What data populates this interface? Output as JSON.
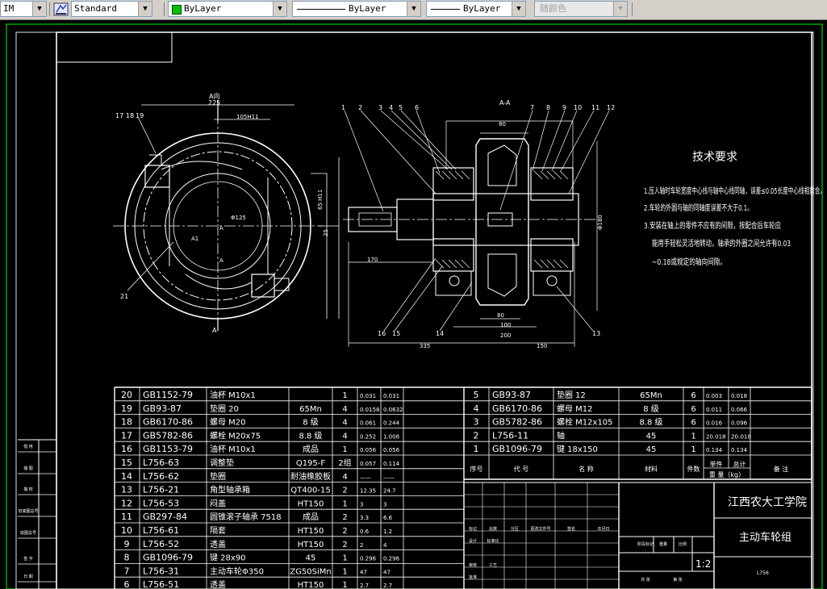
{
  "toolbar": {
    "dimstyle": "IM",
    "textstyle": "Standard",
    "layer": "ByLayer",
    "linetype": "ByLayer",
    "lineweight": "ByLayer",
    "plotstyle": "随颜色"
  },
  "drawing": {
    "view_a_title": "A向",
    "section_title": "A-A",
    "dims": {
      "d225": "225",
      "d105": "105H11",
      "d65": "65 H11",
      "d25": "25",
      "d125": "Φ125",
      "d170": "170",
      "d335": "335",
      "d150": "150",
      "d200": "200",
      "d100": "100",
      "d80": "80",
      "d80b": "80",
      "d200c": "200",
      "d180": "Φ180",
      "dA1": "A1",
      "dA2": "A",
      "dA3": "A",
      "dA4": "A",
      "dA5": "A"
    },
    "callouts_left": [
      "17",
      "18",
      "19",
      "21"
    ],
    "callouts_top": [
      "1",
      "2",
      "3",
      "4",
      "5",
      "6",
      "7",
      "8",
      "9",
      "10",
      "11",
      "12"
    ],
    "callouts_bottom": [
      "16",
      "15",
      "14",
      "13"
    ],
    "tech_title": "技术要求",
    "tech_lines": [
      "1.压入轴时车轮宽度中心线与轴中心线同轴，误差≤0.05长度中心线相重合。",
      "2.车轮的外圆与轴的同轴度误差不大于0.1。",
      "3.安装在轴上的零件不应有的间隙，按配合后车轮应",
      "能用手轻松灵活地转动，轴承的外圈之间允许有0.03",
      "~0.18或规定的轴向间隙。"
    ]
  },
  "bom_left": {
    "rows": [
      {
        "no": "20",
        "code": "GB1152-79",
        "name": "油杯 M10x1",
        "mat": "",
        "qty": "1",
        "w1": "0.031",
        "w2": "0.031"
      },
      {
        "no": "19",
        "code": "GB93-87",
        "name": "垫圈 20",
        "mat": "65Mn",
        "qty": "4",
        "w1": "0.0158",
        "w2": "0.0632"
      },
      {
        "no": "18",
        "code": "GB6170-86",
        "name": "螺母 M20",
        "mat": "8 级",
        "qty": "4",
        "w1": "0.061",
        "w2": "0.244"
      },
      {
        "no": "17",
        "code": "GB5782-86",
        "name": "螺栓 M20x75",
        "mat": "8.8 级",
        "qty": "4",
        "w1": "0.252",
        "w2": "1.008"
      },
      {
        "no": "16",
        "code": "GB1153-79",
        "name": "油杯 M10x1",
        "mat": "成品",
        "qty": "1",
        "w1": "0.056",
        "w2": "0.056"
      },
      {
        "no": "15",
        "code": "L756-63",
        "name": "调整垫",
        "mat": "Q195-F",
        "qty": "2组",
        "w1": "0.057",
        "w2": "0.114"
      },
      {
        "no": "14",
        "code": "L756-62",
        "name": "垫圈",
        "mat": "耐油橡胶板",
        "qty": "4",
        "w1": "——",
        "w2": "——"
      },
      {
        "no": "13",
        "code": "L756-21",
        "name": "角型轴承箱",
        "mat": "QT400-15",
        "qty": "2",
        "w1": "12.35",
        "w2": "24.7"
      },
      {
        "no": "12",
        "code": "L756-53",
        "name": "闷盖",
        "mat": "HT150",
        "qty": "1",
        "w1": "3",
        "w2": "3"
      },
      {
        "no": "11",
        "code": "GB297-84",
        "name": "圆锥滚子轴承 7518",
        "mat": "成品",
        "qty": "2",
        "w1": "3.3",
        "w2": "6.6"
      },
      {
        "no": "10",
        "code": "L756-61",
        "name": "隔套",
        "mat": "HT150",
        "qty": "2",
        "w1": "0.6",
        "w2": "1.2"
      },
      {
        "no": "9",
        "code": "L756-52",
        "name": "透盖",
        "mat": "HT150",
        "qty": "2",
        "w1": "2",
        "w2": "4"
      },
      {
        "no": "8",
        "code": "GB1096-79",
        "name": "键 28x90",
        "mat": "45",
        "qty": "1",
        "w1": "0.296",
        "w2": "0.296"
      },
      {
        "no": "7",
        "code": "L756-31",
        "name": "主动车轮Φ350",
        "mat": "ZG50SiMn",
        "qty": "1",
        "w1": "47",
        "w2": "47"
      },
      {
        "no": "6",
        "code": "L756-51",
        "name": "透盖",
        "mat": "HT150",
        "qty": "1",
        "w1": "2.7",
        "w2": "2.7"
      }
    ]
  },
  "bom_right": {
    "rows": [
      {
        "no": "5",
        "code": "GB93-87",
        "name": "垫圈 12",
        "mat": "65Mn",
        "qty": "6",
        "w1": "0.003",
        "w2": "0.018"
      },
      {
        "no": "4",
        "code": "GB6170-86",
        "name": "螺母 M12",
        "mat": "8 级",
        "qty": "6",
        "w1": "0.011",
        "w2": "0.066"
      },
      {
        "no": "3",
        "code": "GB5782-86",
        "name": "螺栓 M12x105",
        "mat": "8.8 级",
        "qty": "6",
        "w1": "0.016",
        "w2": "0.096"
      },
      {
        "no": "2",
        "code": "L756-11",
        "name": "轴",
        "mat": "45",
        "qty": "1",
        "w1": "20.018",
        "w2": "20.018"
      },
      {
        "no": "1",
        "code": "GB1096-79",
        "name": "键 18x150",
        "mat": "45",
        "qty": "1",
        "w1": "0.134",
        "w2": "0.134"
      }
    ],
    "header": {
      "no": "序号",
      "code": "代  号",
      "name": "名  称",
      "mat": "材料",
      "qty": "件数",
      "w1": "单件",
      "w2": "总计",
      "unit": "重  量（kg）",
      "note": "备  注"
    }
  },
  "title_block": {
    "school": "江西农大工学院",
    "drawing_name": "主动车轮组",
    "scale": "1:2",
    "code": "L756",
    "small_labels": [
      "标记",
      "处数",
      "分区",
      "更改文件号",
      "签名",
      "年月日",
      "设计",
      "标准化",
      "阶段标记",
      "重量",
      "比例",
      "审核",
      "工艺",
      "批准",
      "共  张",
      "第  张"
    ]
  },
  "side_strip": {
    "labels": [
      "借  用",
      "描  图",
      "描  校",
      "旧底图总号",
      "底图总号",
      "签  字",
      "日  期"
    ]
  }
}
